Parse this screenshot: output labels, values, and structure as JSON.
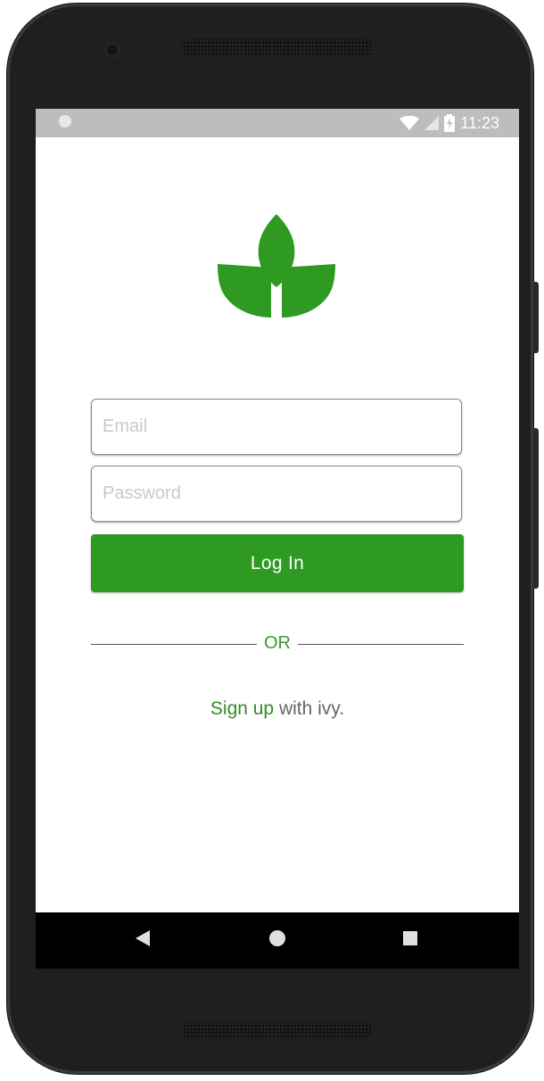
{
  "status_bar": {
    "time": "11:23",
    "icons": [
      "notification-dot-icon",
      "wifi-icon",
      "cell-signal-icon",
      "battery-charging-icon"
    ]
  },
  "logo": {
    "icon": "ivy-leaf-logo",
    "color": "#2e9a22"
  },
  "form": {
    "email_placeholder": "Email",
    "email_value": "",
    "password_placeholder": "Password",
    "password_value": "",
    "login_label": "Log In"
  },
  "divider": {
    "label": "OR"
  },
  "signup": {
    "link_text": "Sign up",
    "suffix_text": " with ivy."
  },
  "nav_bar": {
    "icons": [
      "back-triangle-icon",
      "home-circle-icon",
      "recents-square-icon"
    ]
  },
  "colors": {
    "accent": "#2e9a22",
    "status_bar": "#bdbdbd",
    "nav_bar": "#000000"
  }
}
